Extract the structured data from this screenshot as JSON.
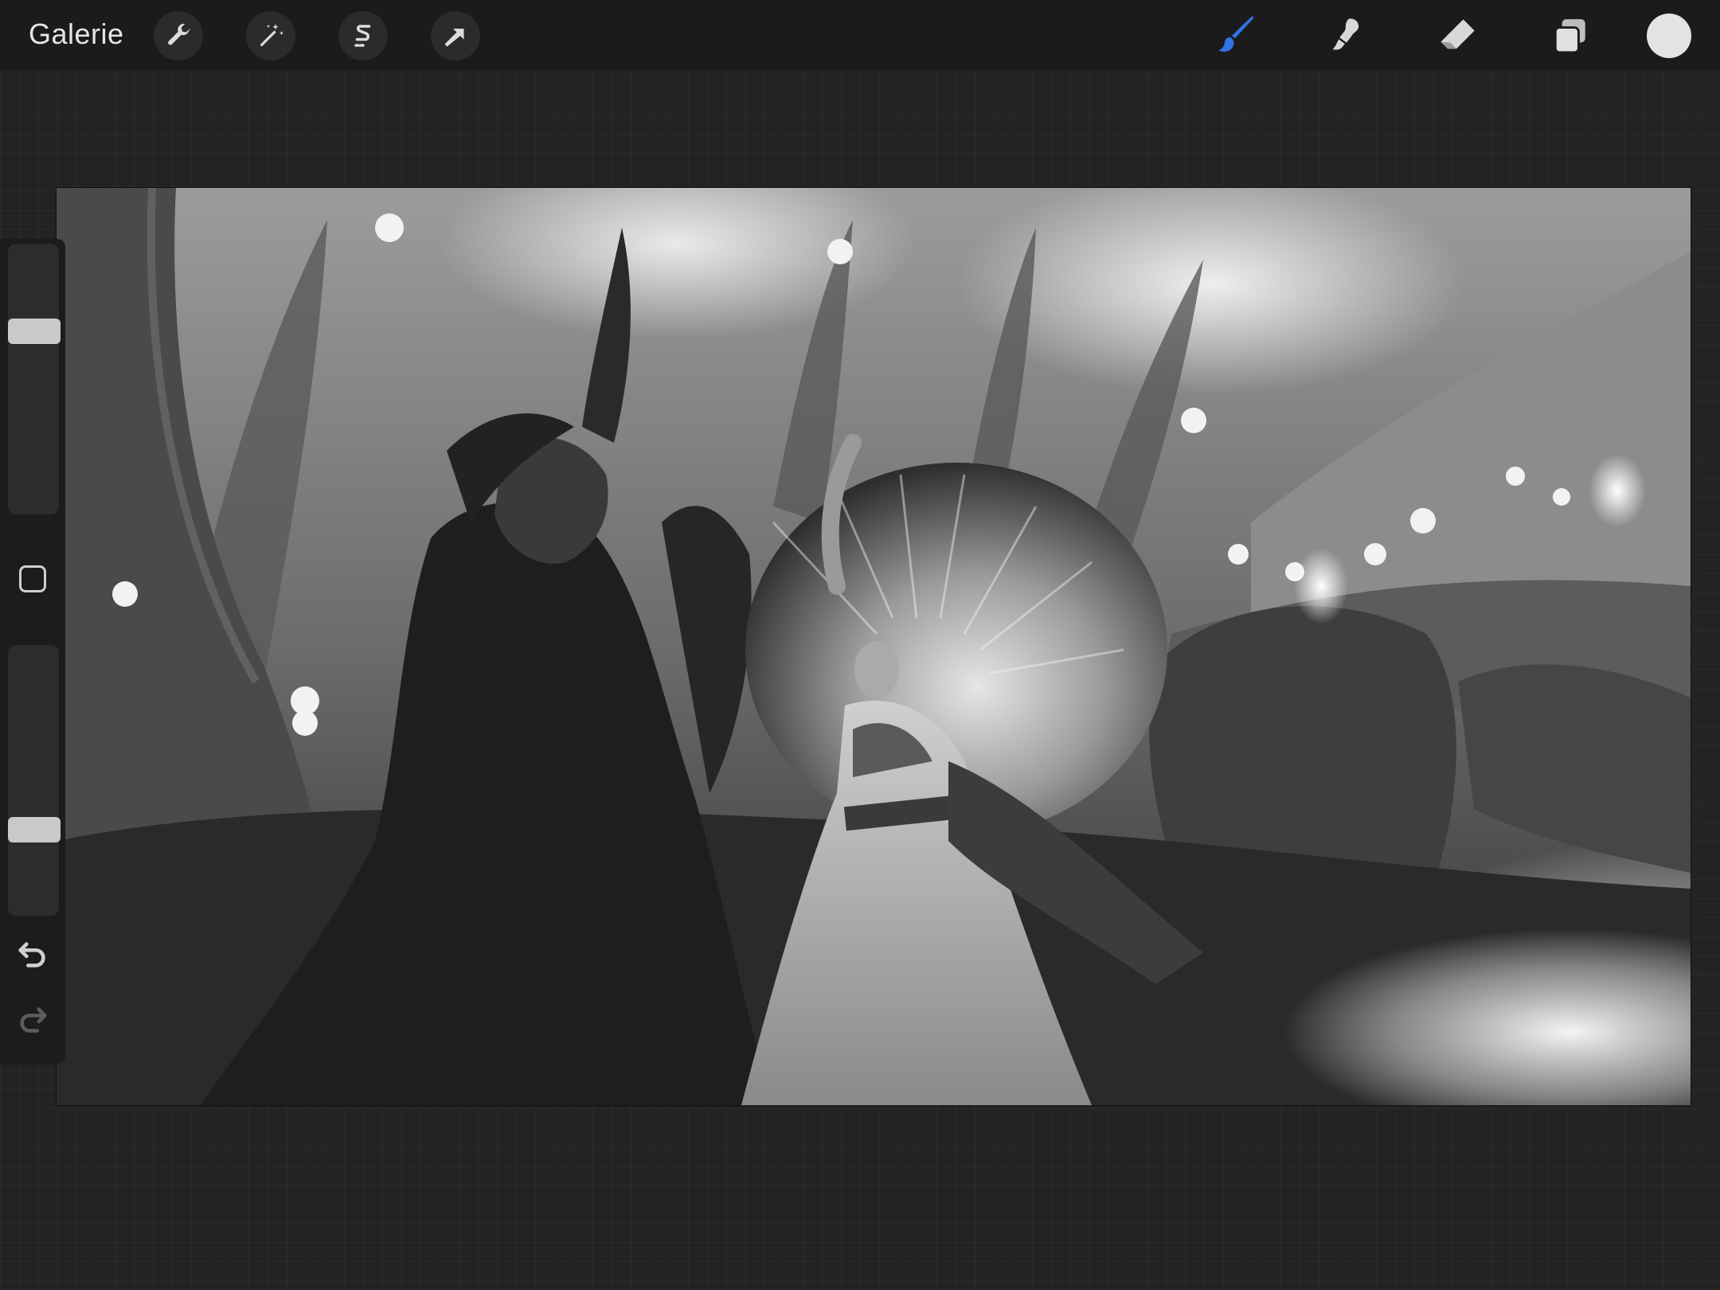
{
  "topbar": {
    "gallery_label": "Galerie",
    "left_tools": [
      "wrench-icon",
      "magic-wand-icon",
      "selection-s-icon",
      "transform-arrow-icon"
    ],
    "right_tools": [
      "brush-icon",
      "smudge-icon",
      "eraser-icon",
      "layers-icon"
    ],
    "active_tool": "brush-icon",
    "active_color": "#2f73e6",
    "current_color": "#e3e3e3"
  },
  "sidebar": {
    "size_slider_level": 0.32,
    "opacity_slider_level": 0.68,
    "modify_button": "square-icon",
    "undo": "undo-icon",
    "redo": "redo-icon"
  }
}
